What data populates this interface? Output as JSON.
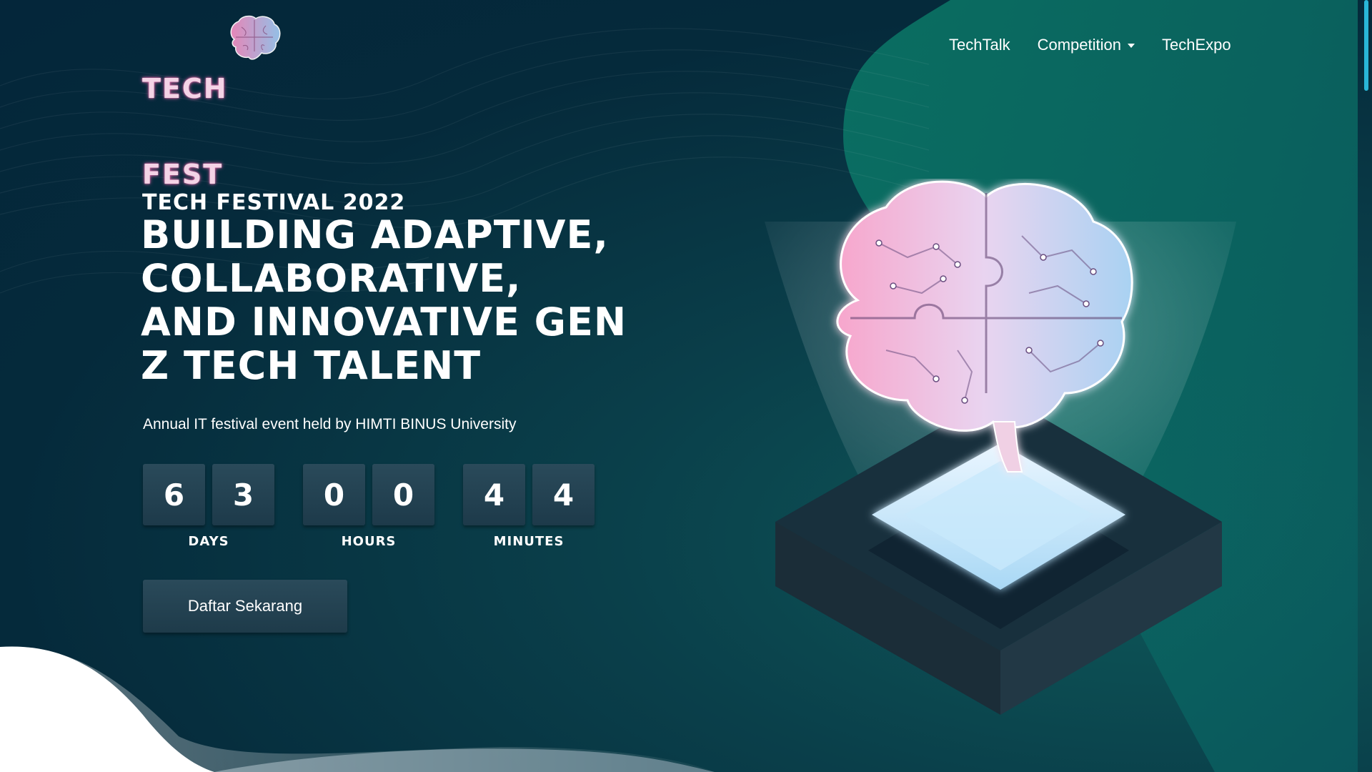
{
  "logo": {
    "line1": "TECH",
    "line2": "FEST",
    "icon": "brain-icon"
  },
  "nav": {
    "items": [
      {
        "label": "TechTalk"
      },
      {
        "label": "Competition",
        "icon": "caret-down-icon"
      },
      {
        "label": "TechExpo"
      }
    ]
  },
  "hero": {
    "eyebrow": "TECH FESTIVAL 2022",
    "headline_lines": [
      "BUILDING ADAPTIVE,",
      "COLLABORATIVE,",
      "AND INNOVATIVE GEN",
      "Z TECH TALENT"
    ],
    "subtitle": "Annual IT festival event held by HIMTI BINUS University",
    "cta_label": "Daftar Sekarang"
  },
  "countdown": {
    "days": {
      "digits": [
        "6",
        "3"
      ],
      "label": "DAYS"
    },
    "hours": {
      "digits": [
        "0",
        "0"
      ],
      "label": "HOURS"
    },
    "minutes": {
      "digits": [
        "4",
        "4"
      ],
      "label": "MINUTES"
    }
  },
  "colors": {
    "background": "#04263a",
    "accent_teal": "#0d7a6a",
    "scroll_thumb": "#29b6d8",
    "logo_pink": "#f4d3e6",
    "countdown_box": "#2a4a5a"
  },
  "illustration": {
    "icon": "brain-hologram-illustration"
  }
}
